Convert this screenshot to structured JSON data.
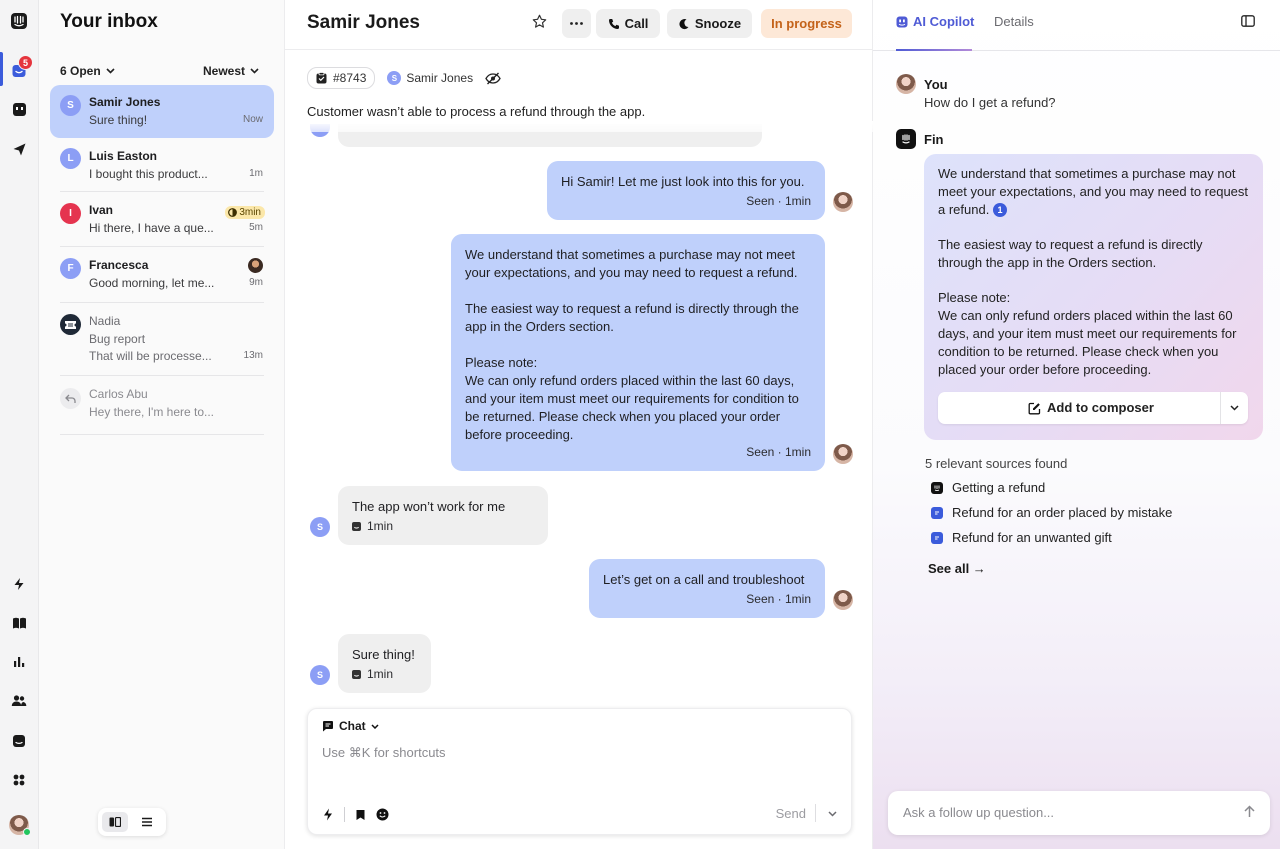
{
  "rail": {
    "badge": "5"
  },
  "inbox": {
    "title": "Your inbox",
    "filter_open": "6 Open",
    "filter_sort": "Newest",
    "conversations": [
      {
        "initial": "S",
        "name": "Samir Jones",
        "preview": "Sure thing!",
        "time": "Now",
        "color": "#8c9ef5"
      },
      {
        "initial": "L",
        "name": "Luis Easton",
        "preview": "I bought this product...",
        "time": "1m",
        "color": "#8c9ef5"
      },
      {
        "initial": "I",
        "name": "Ivan",
        "preview": "Hi there, I have a que...",
        "time": "5m",
        "color": "#e5344f",
        "chip": "3min"
      },
      {
        "initial": "F",
        "name": "Francesca",
        "preview": "Good morning, let me...",
        "time": "9m",
        "color": "#8c9ef5"
      },
      {
        "initial": "",
        "name": "Nadia",
        "subject": "Bug report",
        "preview": "That will be processe...",
        "time": "13m",
        "color": "#1f2937"
      },
      {
        "initial": "",
        "name": "Carlos Abu",
        "preview": "Hey there, I'm here to...",
        "time": "",
        "color": "#e9e9ec"
      }
    ]
  },
  "conversation": {
    "title": "Samir Jones",
    "call_label": "Call",
    "snooze_label": "Snooze",
    "status_label": "In progress",
    "ticket_id": "#8743",
    "customer_name": "Samir Jones",
    "summary": "Customer wasn’t able to process a refund through the app.",
    "messages": [
      {
        "dir": "out",
        "text": "Hi Samir! Let me just look into this for you.",
        "footer": "Seen · 1min"
      },
      {
        "dir": "out",
        "p1": "We understand that sometimes a purchase may not meet your expectations, and you may need to request a refund.",
        "p2": "The easiest way to request a refund is directly through the app in the Orders section.",
        "p3": "Please note:",
        "p4": "We can only refund orders placed within the last 60 days, and your item must meet our requirements for condition to be returned. Please check when you placed your order before proceeding.",
        "footer": "Seen · 1min"
      },
      {
        "dir": "in",
        "text": "The app won’t work for me",
        "footer": "1min"
      },
      {
        "dir": "out",
        "text": "Let’s get on a call and troubleshoot",
        "footer": "Seen · 1min"
      },
      {
        "dir": "in",
        "text": "Sure thing!",
        "footer": "1min"
      }
    ],
    "composer": {
      "mode": "Chat",
      "placeholder": "Use ⌘K for shortcuts",
      "send": "Send"
    }
  },
  "copilot": {
    "tab_active": "AI Copilot",
    "tab_details": "Details",
    "you_label": "You",
    "question": "How do I get a refund?",
    "fin_label": "Fin",
    "answer_p1": "We understand that sometimes a purchase may not meet your expectations, and you may need to request a refund.",
    "cite": "1",
    "answer_p2": "The easiest way to request a refund is directly through the app in the Orders section.",
    "answer_p3": "Please note:",
    "answer_p4": "We can only refund orders placed within the last 60 days, and your item must meet our requirements for condition to be returned. Please check when you placed your order before proceeding.",
    "add_label": "Add to composer",
    "sources_title": "5 relevant sources found",
    "sources": [
      "Getting a refund",
      "Refund for an order placed by mistake",
      "Refund for an unwanted gift"
    ],
    "see_all": "See all →",
    "followup_placeholder": "Ask a follow up question..."
  }
}
